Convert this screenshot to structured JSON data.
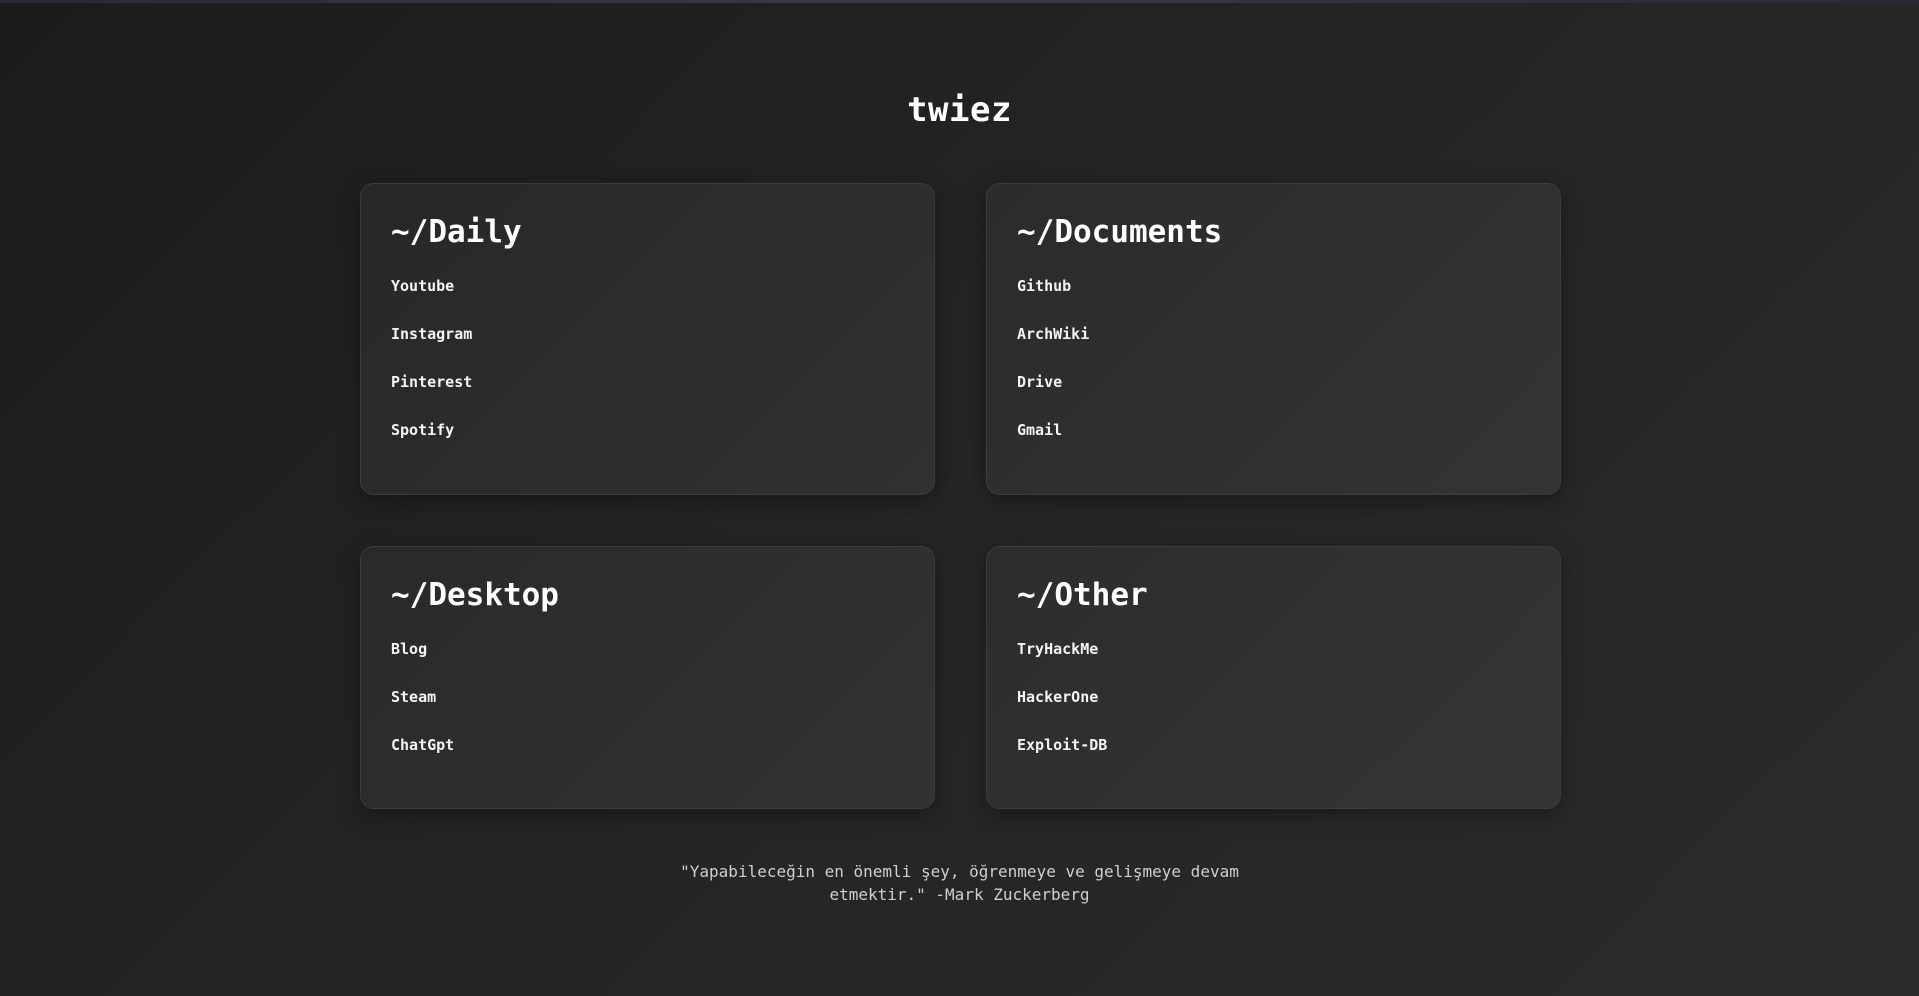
{
  "site": {
    "title": "twiez",
    "accent_line_color": "#3a3a48"
  },
  "cards": [
    {
      "title": "~/Daily",
      "links": [
        "Youtube",
        "Instagram",
        "Pinterest",
        "Spotify"
      ]
    },
    {
      "title": "~/Documents",
      "links": [
        "Github",
        "ArchWiki",
        "Drive",
        "Gmail"
      ]
    },
    {
      "title": "~/Desktop",
      "links": [
        "Blog",
        "Steam",
        "ChatGpt"
      ]
    },
    {
      "title": "~/Other",
      "links": [
        "TryHackMe",
        "HackerOne",
        "Exploit-DB"
      ]
    }
  ],
  "quote": {
    "line1": "\"Yapabileceğin en önemli şey, öğrenmeye ve gelişmeye devam",
    "line2": "etmektir.\" -Mark Zuckerberg"
  }
}
